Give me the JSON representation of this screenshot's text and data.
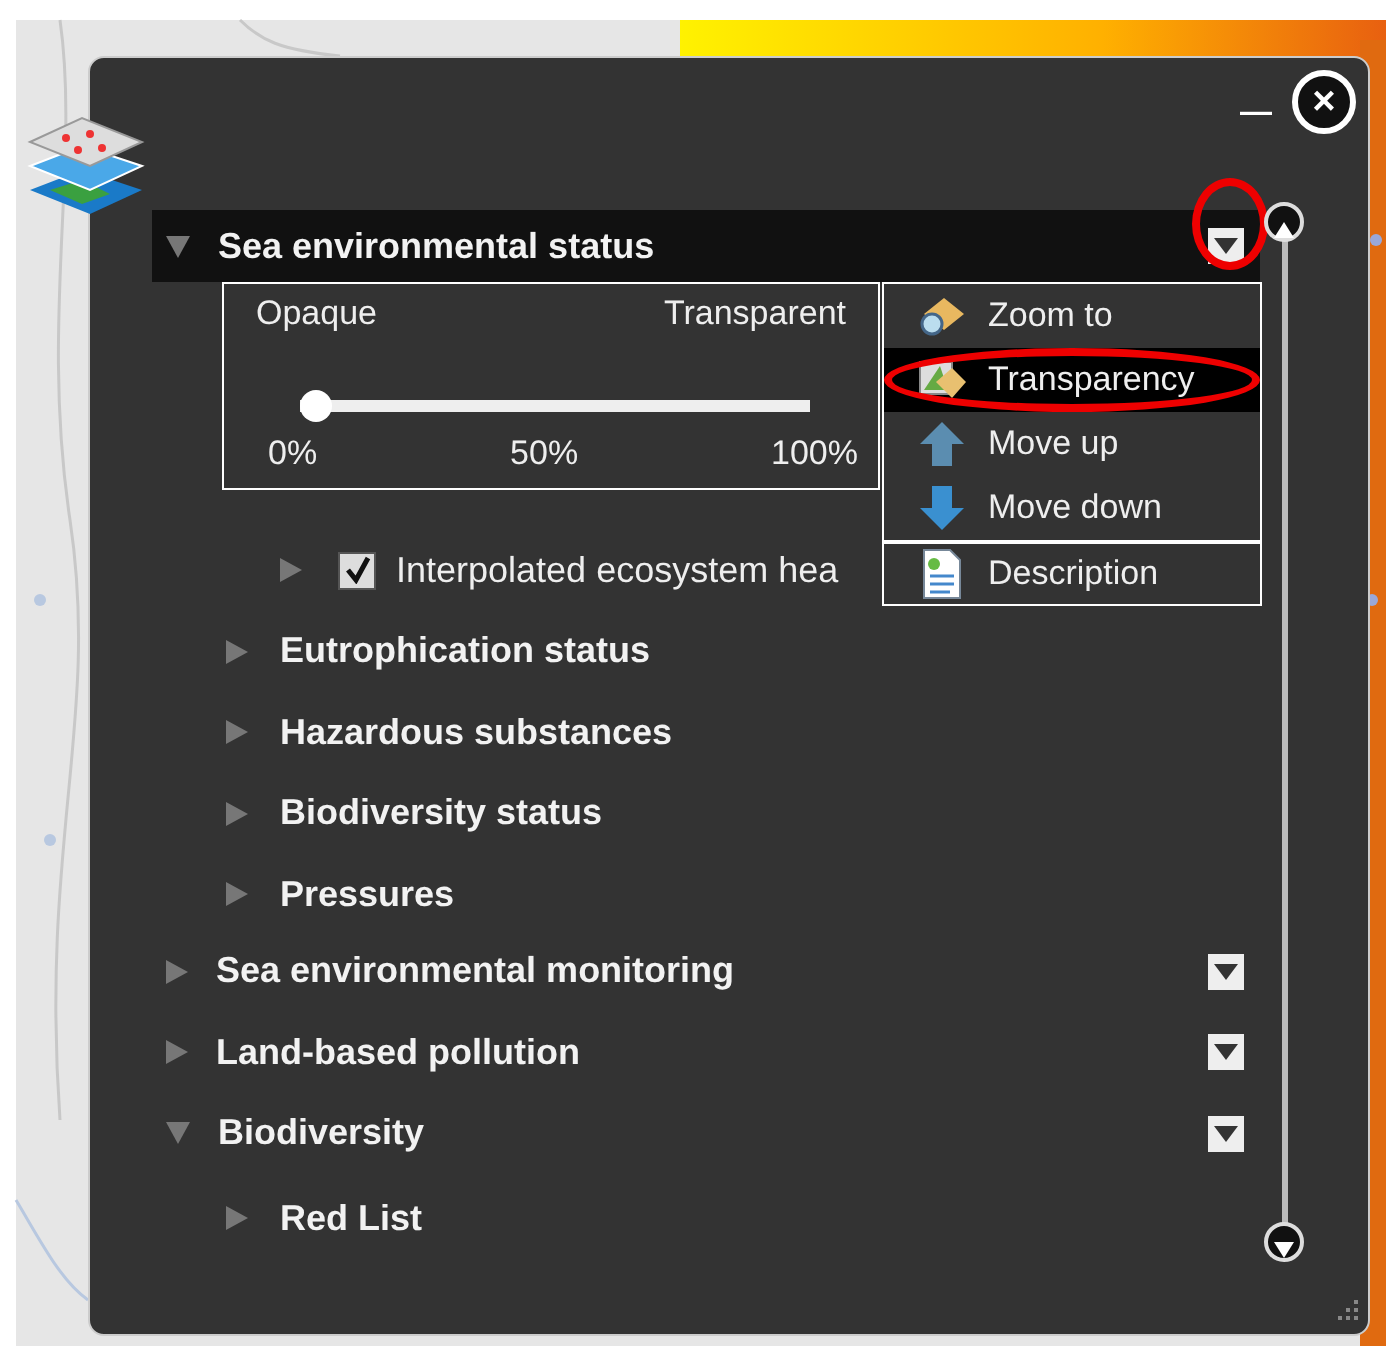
{
  "window": {
    "minimize": "—",
    "close": "×"
  },
  "layers": [
    {
      "label": "Sea environmental status",
      "expanded": true,
      "menu_circled": true,
      "children": [
        {
          "label": "Interpolated ecosystem hea",
          "kind": "layer",
          "checked": true
        },
        {
          "label": "Eutrophication status",
          "kind": "group",
          "expanded": false
        },
        {
          "label": "Hazardous substances",
          "kind": "group",
          "expanded": false
        },
        {
          "label": "Biodiversity status",
          "kind": "group",
          "expanded": false
        },
        {
          "label": "Pressures",
          "kind": "group",
          "expanded": false
        }
      ]
    },
    {
      "label": "Sea environmental monitoring",
      "expanded": false,
      "menu_circled": false
    },
    {
      "label": "Land-based pollution",
      "expanded": false,
      "menu_circled": false
    },
    {
      "label": "Biodiversity",
      "expanded": true,
      "menu_circled": false,
      "children": [
        {
          "label": "Red List",
          "kind": "group",
          "expanded": false
        }
      ]
    }
  ],
  "transparency": {
    "left_label": "Opaque",
    "right_label": "Transparent",
    "level": 0,
    "ticks": [
      "0%",
      "50%",
      "100%"
    ]
  },
  "context_menu": [
    {
      "label": "Zoom to",
      "kind": "zoom",
      "selected": false,
      "circled": false,
      "divider_before": false
    },
    {
      "label": "Transparency",
      "kind": "transparency",
      "selected": true,
      "circled": true,
      "divider_before": false
    },
    {
      "label": "Move up",
      "kind": "up",
      "selected": false,
      "circled": false,
      "divider_before": false
    },
    {
      "label": "Move down",
      "kind": "down",
      "selected": false,
      "circled": false,
      "divider_before": false
    },
    {
      "label": "Description",
      "kind": "doc",
      "selected": false,
      "circled": false,
      "divider_before": true
    }
  ]
}
